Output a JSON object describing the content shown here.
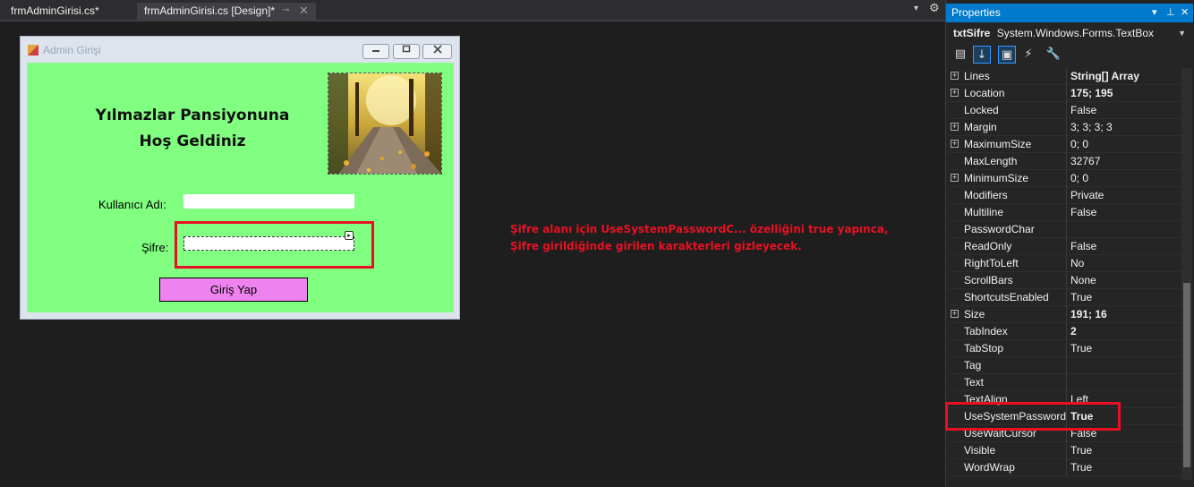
{
  "tabs": [
    {
      "label": "frmAdminGirisi.cs*"
    },
    {
      "label": "frmAdminGirisi.cs [Design]*",
      "pin": "⊸",
      "close": "✕"
    }
  ],
  "tab_menu_icon": "▾",
  "tab_gear_icon": "⚙",
  "form": {
    "title": "Admin Girişi",
    "greeting": "Yılmazlar Pansiyonuna Hoş Geldiniz",
    "username_label": "Kullanıcı Adı:",
    "password_label": "Şifre:",
    "login_button": "Giriş Yap",
    "client_color": "#80ff80",
    "button_color": "#ee82ee"
  },
  "annotation": {
    "line1": "Şifre alanı için UseSystemPasswordC... özelliğini true yapınca,",
    "line2": "Şifre girildiğinde girilen karakterleri gizleyecek.",
    "color": "#e81123"
  },
  "properties_panel": {
    "title": "Properties",
    "object_name": "txtSifre",
    "object_type": "System.Windows.Forms.TextBox",
    "rows": [
      {
        "name": "Lines",
        "value": "String[] Array",
        "expandable": true,
        "bold": true
      },
      {
        "name": "Location",
        "value": "175; 195",
        "expandable": true,
        "bold": true
      },
      {
        "name": "Locked",
        "value": "False",
        "expandable": false,
        "bold": false
      },
      {
        "name": "Margin",
        "value": "3; 3; 3; 3",
        "expandable": true,
        "bold": false
      },
      {
        "name": "MaximumSize",
        "value": "0; 0",
        "expandable": true,
        "bold": false
      },
      {
        "name": "MaxLength",
        "value": "32767",
        "expandable": false,
        "bold": false
      },
      {
        "name": "MinimumSize",
        "value": "0; 0",
        "expandable": true,
        "bold": false
      },
      {
        "name": "Modifiers",
        "value": "Private",
        "expandable": false,
        "bold": false
      },
      {
        "name": "Multiline",
        "value": "False",
        "expandable": false,
        "bold": false
      },
      {
        "name": "PasswordChar",
        "value": "",
        "expandable": false,
        "bold": false
      },
      {
        "name": "ReadOnly",
        "value": "False",
        "expandable": false,
        "bold": false
      },
      {
        "name": "RightToLeft",
        "value": "No",
        "expandable": false,
        "bold": false
      },
      {
        "name": "ScrollBars",
        "value": "None",
        "expandable": false,
        "bold": false
      },
      {
        "name": "ShortcutsEnabled",
        "value": "True",
        "expandable": false,
        "bold": false
      },
      {
        "name": "Size",
        "value": "191; 16",
        "expandable": true,
        "bold": true
      },
      {
        "name": "TabIndex",
        "value": "2",
        "expandable": false,
        "bold": true
      },
      {
        "name": "TabStop",
        "value": "True",
        "expandable": false,
        "bold": false
      },
      {
        "name": "Tag",
        "value": "",
        "expandable": false,
        "bold": false
      },
      {
        "name": "Text",
        "value": "",
        "expandable": false,
        "bold": false
      },
      {
        "name": "TextAlign",
        "value": "Left",
        "expandable": false,
        "bold": false
      },
      {
        "name": "UseSystemPasswordC",
        "value": "True",
        "expandable": false,
        "bold": true
      },
      {
        "name": "UseWaitCursor",
        "value": "False",
        "expandable": false,
        "bold": false
      },
      {
        "name": "Visible",
        "value": "True",
        "expandable": false,
        "bold": false
      },
      {
        "name": "WordWrap",
        "value": "True",
        "expandable": false,
        "bold": false
      }
    ]
  },
  "colors": {
    "ide_background": "#1e1e1e",
    "accent": "#007acc",
    "highlight": "#e81123"
  }
}
